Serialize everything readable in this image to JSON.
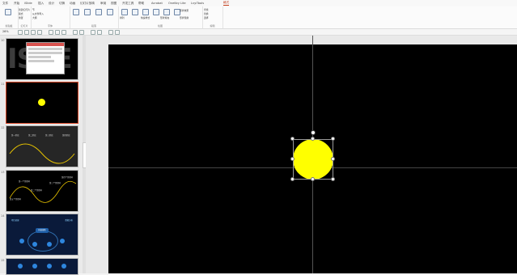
{
  "tabs": [
    "文件",
    "开始",
    "iSlide",
    "插入",
    "设计",
    "切换",
    "动画",
    "幻灯片放映",
    "审阅",
    "视图",
    "开发工具",
    "帮助",
    "Acrobat",
    "OneKey Lite",
    "LvyiTools",
    "格式"
  ],
  "ribbon": {
    "groups": [
      "剪贴板",
      "幻灯片",
      "字体",
      "段落",
      "绘图",
      "编辑"
    ],
    "items": [
      "新建幻灯片",
      "版式",
      "重置",
      "节",
      "从文件导入",
      "大纲",
      "排列",
      "快速样式",
      "形状填充",
      "形状轮廓",
      "形状效果",
      "查找",
      "替换",
      "选择"
    ],
    "zoom": "26%"
  },
  "thumbnails": {
    "numbers": [
      "10",
      "11",
      "12",
      "13",
      "14",
      "15"
    ],
    "slide1_text": "ISTE",
    "slide3_labels": [
      "第一阶段",
      "第二阶段",
      "第三阶段",
      "第四阶段"
    ],
    "slide4_labels": [
      "第一个里程碑",
      "第二个里程碑",
      "第三个里程碑",
      "第四个里程碑",
      "第五个里程碑"
    ],
    "slide5_center": "科技创新",
    "slide5_corner_left": "项目进展",
    "slide5_corner_right": "数据分析"
  },
  "colors": {
    "accent": "#c43e1c",
    "shape": "#ffff00",
    "slide_bg": "#000000"
  }
}
